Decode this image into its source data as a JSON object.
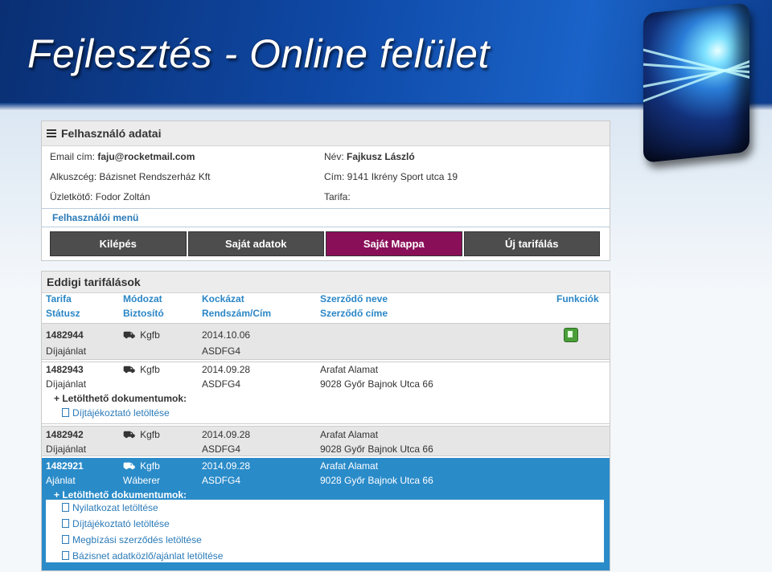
{
  "slide": {
    "title": "Fejlesztés - Online felület"
  },
  "user_panel": {
    "title": "Felhasználó adatai",
    "email_label": "Email cím: ",
    "email": "faju@rocketmail.com",
    "partner": "Alkuszcég: Bázisnet Rendszerház Kft",
    "agent": "Üzletkötő: Fodor Zoltán",
    "name_label": "Név: ",
    "name": "Fajkusz László",
    "address": "Cím: 9141 Ikrény Sport utca 19",
    "tariff": "Tarifa:",
    "menu_label": "Felhasználói menü",
    "menu": [
      {
        "label": "Kilépés",
        "active": false
      },
      {
        "label": "Saját adatok",
        "active": false
      },
      {
        "label": "Saját Mappa",
        "active": true
      },
      {
        "label": "Új tarifálás",
        "active": false
      }
    ]
  },
  "history": {
    "title": "Eddigi tarifálások",
    "headers": {
      "tarifa": "Tarifa",
      "statusz": "Státusz",
      "modozat": "Módozat",
      "biztosito": "Biztosító",
      "kockazat": "Kockázat",
      "rendszam": "Rendszám/Cím",
      "szerzodo_neve": "Szerződő neve",
      "szerzodo_cime": "Szerződő címe",
      "funkciok": "Funkciók"
    },
    "docs_title": "+ Letölthető dokumentumok:",
    "rows": [
      {
        "id": "1482944",
        "status": "Díjajánlat",
        "type": "Kgfb",
        "insurer": "",
        "date": "2014.10.06",
        "plate": "ASDFG4",
        "name": "",
        "address": ""
      },
      {
        "id": "1482943",
        "status": "Díjajánlat",
        "type": "Kgfb",
        "insurer": "",
        "date": "2014.09.28",
        "plate": "ASDFG4",
        "name": "Arafat Alamat",
        "address": "9028 Győr Bajnok Utca 66",
        "docs": [
          "Díjtájékoztató letöltése"
        ]
      },
      {
        "id": "1482942",
        "status": "Díjajánlat",
        "type": "Kgfb",
        "insurer": "",
        "date": "2014.09.28",
        "plate": "ASDFG4",
        "name": "Arafat Alamat",
        "address": "9028 Győr Bajnok Utca 66"
      },
      {
        "id": "1482921",
        "status": "Ajánlat",
        "type": "Kgfb",
        "insurer": "Wáberer",
        "date": "2014.09.28",
        "plate": "ASDFG4",
        "name": "Arafat Alamat",
        "address": "9028 Győr Bajnok Utca 66",
        "docs": [
          "Nyilatkozat letöltése",
          "Díjtájékoztató letöltése",
          "Megbízási szerződés letöltése",
          "Bázisnet adatközlő/ajánlat letöltése"
        ]
      }
    ]
  },
  "colors": {
    "active_menu": "#8a0f59",
    "selected_row": "#2a8bc9",
    "link": "#2a86c6"
  }
}
